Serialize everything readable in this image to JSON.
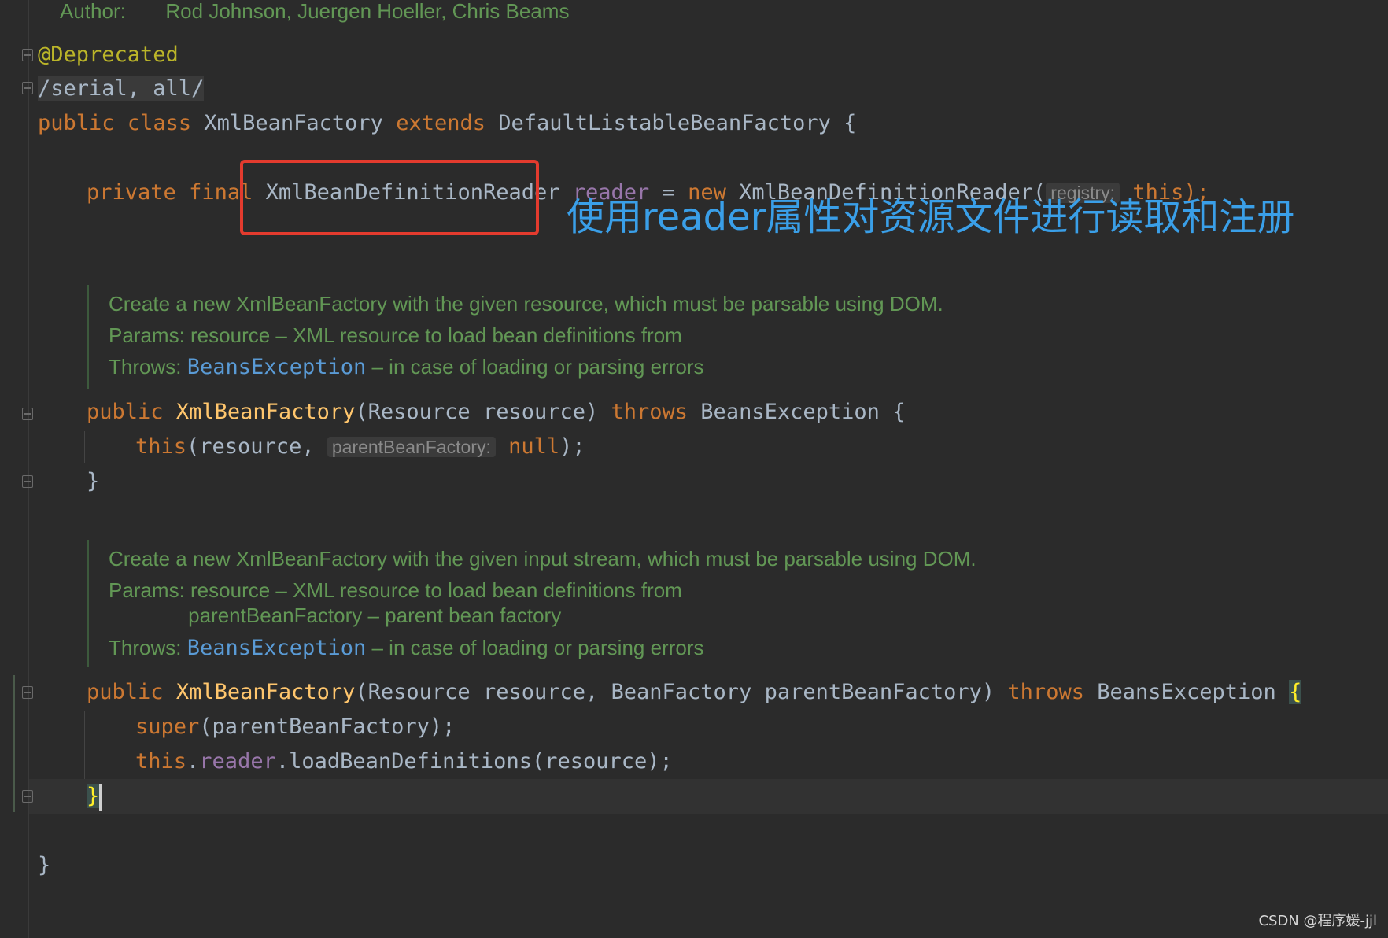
{
  "author": {
    "label": "Author:",
    "names": "Rod Johnson, Juergen Hoeller, Chris Beams"
  },
  "annotation": {
    "deprecated": "@Deprecated",
    "suppress": "/serial, all/"
  },
  "class_decl": {
    "kw1": "public",
    "kw2": "class",
    "name": "XmlBeanFactory",
    "kw3": "extends",
    "parent": "DefaultListableBeanFactory",
    "brace": "{"
  },
  "field_decl": {
    "kw1": "private",
    "kw2": "final",
    "type": "XmlBeanDefinitionReader",
    "name": "reader",
    "eq": "=",
    "kw_new": "new",
    "ctor": "XmlBeanDefinitionReader(",
    "hint": "registry:",
    "arg": "this",
    "end": ");"
  },
  "overlay": {
    "caption": "使用reader属性对资源文件进行读取和注册",
    "watermark": "CSDN @程序媛-jjl"
  },
  "doc1": {
    "desc": "Create a new XmlBeanFactory with the given resource, which must be parsable using DOM.",
    "params": "Params: resource – XML resource to load bean definitions from",
    "throws_label": "Throws: ",
    "throws_link": "BeansException",
    "throws_rest": " – in case of loading or parsing errors"
  },
  "ctor1": {
    "kw": "public",
    "name": "XmlBeanFactory",
    "sig": "(Resource resource) ",
    "throws_kw": "throws",
    "exc": " BeansException {",
    "body_kw": "this",
    "body_a": "(resource, ",
    "hint": "parentBeanFactory:",
    "body_null": " null",
    "body_end": ");",
    "close": "}"
  },
  "doc2": {
    "desc": "Create a new XmlBeanFactory with the given input stream, which must be parsable using DOM.",
    "params": "Params: resource – XML resource to load bean definitions from",
    "params2": "              parentBeanFactory – parent bean factory",
    "throws_label": "Throws: ",
    "throws_link": "BeansException",
    "throws_rest": " – in case of loading or parsing errors"
  },
  "ctor2": {
    "kw": "public",
    "name": "XmlBeanFactory",
    "sig": "(Resource resource, BeanFactory parentBeanFactory) ",
    "throws_kw": "throws",
    "exc": " BeansException ",
    "open": "{",
    "super_kw": "super",
    "super_rest": "(parentBeanFactory);",
    "this_kw": "this",
    "dot": ".",
    "field": "reader",
    "call": ".loadBeanDefinitions(resource);",
    "close": "}"
  },
  "class_close": "}"
}
